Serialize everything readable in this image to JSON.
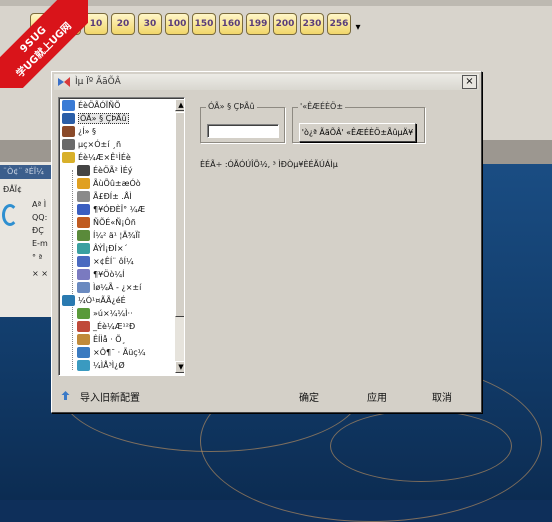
{
  "watermark": {
    "line1": "9SUG",
    "line2": "学UG就上UG网"
  },
  "toolbar": {
    "buttons": [
      "8",
      "9",
      "10",
      "20",
      "30",
      "100",
      "150",
      "160",
      "199",
      "200",
      "230",
      "256"
    ]
  },
  "background_panel": {
    "title": "¨Ò¢¨ ªÉÏ¼",
    "heading": "ÐÅÏ¢",
    "fields": [
      "Aª Ì",
      "QQ:",
      "ÐÇ",
      "E-m",
      "° ª",
      "× ×"
    ]
  },
  "dialog": {
    "title": "Ìµ Ïº ÃãÕÂ",
    "close_label": "×",
    "tree": {
      "items": [
        {
          "label": "ÉèÖÃÓÏÑÕ",
          "icon": "settings-folder-icon",
          "color": "#3a7bd5",
          "level": 0
        },
        {
          "label": "ÓÂ» § ÇÞÃû",
          "icon": "user-config-icon",
          "color": "#2a5ea8",
          "level": 0,
          "selected": true
        },
        {
          "label": "¿Í» §",
          "icon": "person-icon",
          "color": "#8a4a2a",
          "level": 0
        },
        {
          "label": "µç×Ó±í ¸ñ",
          "icon": "grid-icon",
          "color": "#6a6a6a",
          "level": 0
        },
        {
          "label": "Éè¼Æ×Ê¹ÌÉè",
          "icon": "folder-icon",
          "color": "#d8b02a",
          "level": 0
        },
        {
          "label": "ÉèÖÃ² ÌÉý",
          "icon": "table-icon",
          "color": "#444444",
          "level": 1
        },
        {
          "label": "ÃùÕû±æÓò",
          "icon": "box-icon",
          "color": "#e0a020",
          "level": 1
        },
        {
          "label": "Ã£ÐÍ± .ÅÌ",
          "icon": "drive-icon",
          "color": "#8a8a8a",
          "level": 1
        },
        {
          "label": "¶¥ÓÐÈÎ° ¼Æ",
          "icon": "book-icon",
          "color": "#3a5ec0",
          "level": 1
        },
        {
          "label": "ÑÕÉ«Ñ¡Ôñ",
          "icon": "palette-icon",
          "color": "#c05a20",
          "level": 1
        },
        {
          "label": "Í¼² ä¹ ¦Ä¾Ïî",
          "icon": "chart-icon",
          "color": "#5a8a3a",
          "level": 1
        },
        {
          "label": "ÂÝÎ¡ÐÍ×´",
          "icon": "pin-icon",
          "color": "#3aa0a0",
          "level": 1
        },
        {
          "label": "×¢ÊÍ¨ ôÍ¼",
          "icon": "pen-icon",
          "color": "#4a6ac0",
          "level": 1
        },
        {
          "label": "¶¥Öò¼Í",
          "icon": "page-icon",
          "color": "#7a7ac0",
          "level": 1
        },
        {
          "label": "Ìø¼Ã - ¿×±í",
          "icon": "list-icon",
          "color": "#6a8ac0",
          "level": 1
        },
        {
          "label": "¼Ó¹¤ÃÃ¿éÉ",
          "icon": "tools-icon",
          "color": "#2a7ab0",
          "level": 0
        },
        {
          "label": "»ú×¼¼Ì··",
          "icon": "gear-icon",
          "color": "#5a9a3a",
          "level": 1
        },
        {
          "label": "_Éè¼Æ¹²Ð",
          "icon": "layer-icon",
          "color": "#c04a3a",
          "level": 1
        },
        {
          "label": "ÊÍÌå · Õ¸",
          "icon": "shape-icon",
          "color": "#c08a3a",
          "level": 1
        },
        {
          "label": "×Ô¶¯ · Ãüç¼",
          "icon": "auto-icon",
          "color": "#3a7ac0",
          "level": 1
        },
        {
          "label": "¼ÌÅ³Ì¿Ø",
          "icon": "flow-icon",
          "color": "#3a9ac0",
          "level": 1
        }
      ]
    },
    "name_group": {
      "title": "ÓÃ» § ÇÞÃû",
      "value": ""
    },
    "action_group": {
      "title": "'«ÊÆÉÈÖ±",
      "button": "'ò¿ª ÃãÕÂ' «ÊÆÉÈÖ±ÃûµÄ¥"
    },
    "info_text": "ÈÉÃ÷ :ÓÃÓÚÎÕ½, ³ ÌÐÒµ¥ÈÉÃÚÁÌµ",
    "footer": {
      "import_label": "导入旧新配置",
      "ok": "确定",
      "apply": "应用",
      "cancel": "取消"
    }
  }
}
